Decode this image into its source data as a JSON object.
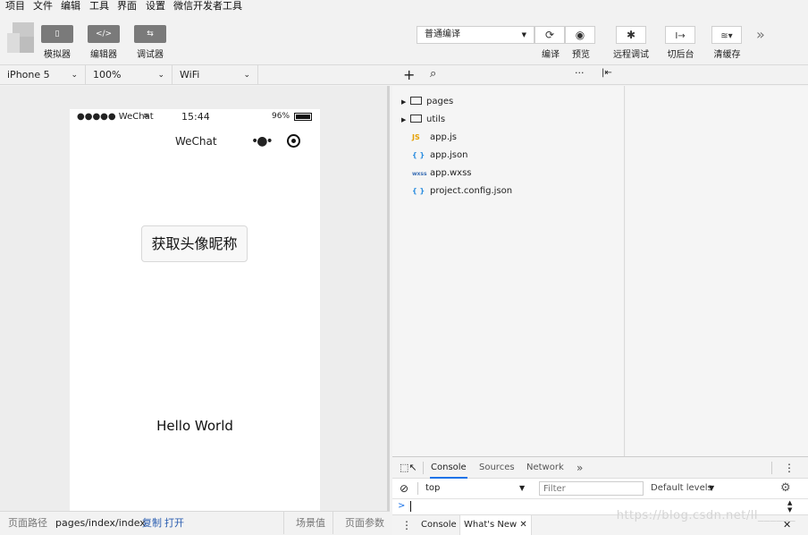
{
  "menu": [
    "项目",
    "文件",
    "编辑",
    "工具",
    "界面",
    "设置",
    "微信开发者工具"
  ],
  "toolbar": {
    "modes": [
      {
        "icon": "phone-icon",
        "glyph": "▯",
        "label": "模拟器"
      },
      {
        "icon": "code-icon",
        "glyph": "</>",
        "label": "编辑器"
      },
      {
        "icon": "debug-icon",
        "glyph": "⇆",
        "label": "调试器"
      }
    ],
    "compile_mode": "普通编译",
    "actions": [
      {
        "icon": "refresh-icon",
        "glyph": "⟳",
        "label": "编译"
      },
      {
        "icon": "eye-icon",
        "glyph": "◉",
        "label": "预览"
      },
      {
        "icon": "bug-icon",
        "glyph": "✱",
        "label": "远程调试"
      },
      {
        "icon": "background-icon",
        "glyph": "I→",
        "label": "切后台"
      },
      {
        "icon": "layers-icon",
        "glyph": "≋▾",
        "label": "清缓存"
      }
    ],
    "more": "»"
  },
  "devicebar": {
    "device": "iPhone 5",
    "zoom": "100%",
    "network": "WiFi"
  },
  "simulator": {
    "status": {
      "signal": "●●●●● WeChat",
      "time": "15:44",
      "battery": "96%"
    },
    "nav_title": "WeChat",
    "button_label": "获取头像昵称",
    "hello": "Hello World"
  },
  "pathbar": {
    "label": "页面路径",
    "path": "pages/index/index",
    "copy": "复制",
    "open": "打开",
    "scene": "场景值",
    "params": "页面参数"
  },
  "files": [
    {
      "kind": "folder",
      "name": "pages"
    },
    {
      "kind": "folder",
      "name": "utils"
    },
    {
      "kind": "js",
      "icon": "JS",
      "name": "app.js"
    },
    {
      "kind": "json",
      "icon": "{ }",
      "name": "app.json"
    },
    {
      "kind": "wxss",
      "icon": "wxss",
      "name": "app.wxss"
    },
    {
      "kind": "json",
      "icon": "{ }",
      "name": "project.config.json"
    }
  ],
  "colors": {
    "js": "#e5a000",
    "json": "#2f8fe0",
    "wxss": "#3b6fb5",
    "accent": "#1a73e8"
  },
  "devtools": {
    "tabs": [
      "Console",
      "Sources",
      "Network"
    ],
    "more": "»",
    "context": "top",
    "filter_placeholder": "Filter",
    "levels": "Default levels",
    "prompt": ">",
    "drawer_tabs": [
      "Console",
      "What's New"
    ]
  },
  "watermark": "https://blog.csdn.net/ll______"
}
